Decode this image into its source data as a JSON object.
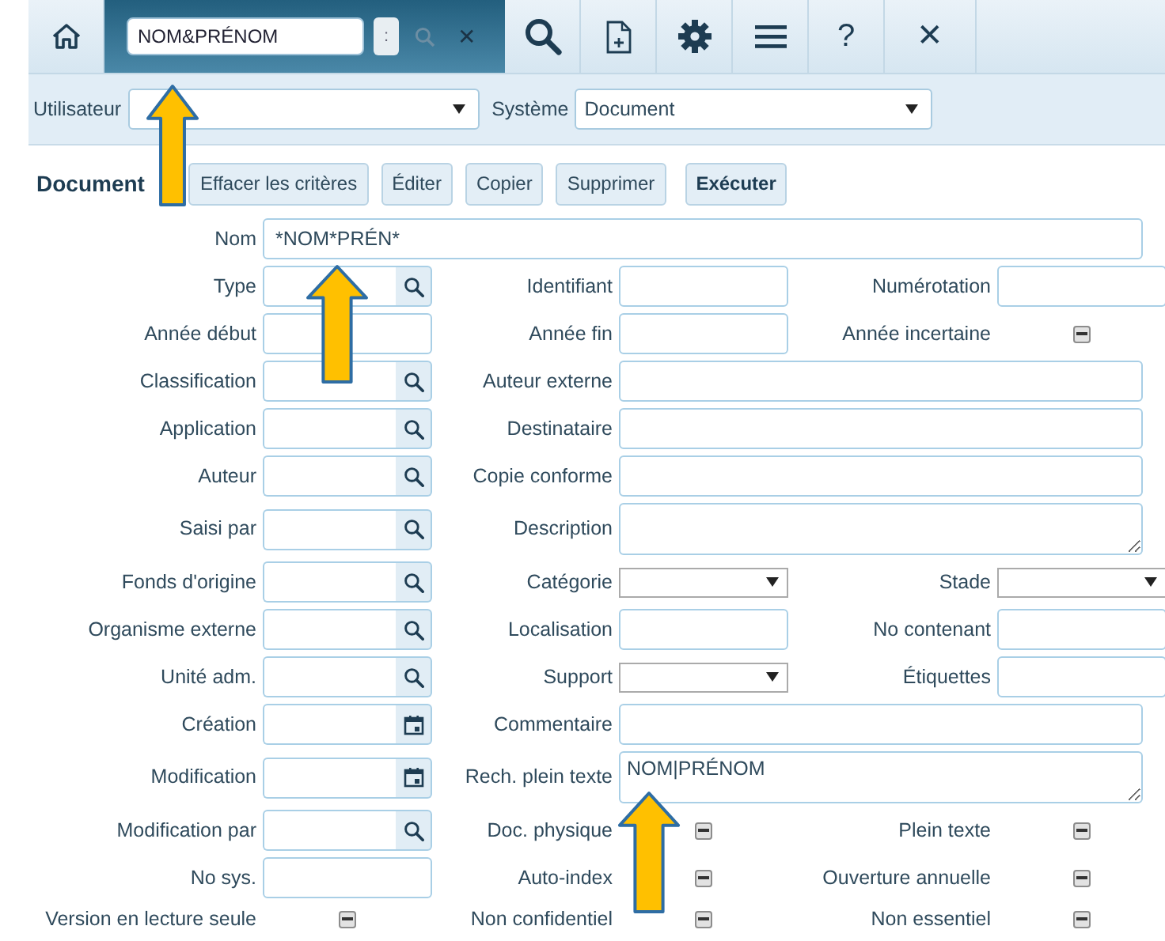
{
  "toolbar": {
    "search_panel": {
      "value": "NOM&PRÉNOM",
      "separator_button": ":",
      "close_label": "✕"
    },
    "buttons": [
      {
        "kind": "search"
      },
      {
        "kind": "new-document"
      },
      {
        "kind": "settings"
      },
      {
        "kind": "menu"
      },
      {
        "kind": "text",
        "label": "?"
      },
      {
        "kind": "text",
        "label": "✕"
      }
    ]
  },
  "filters": [
    {
      "label": "Utilisateur"
    },
    {
      "label": "Système",
      "value": "Document"
    }
  ],
  "form": {
    "title": "Document",
    "actions": [
      {
        "label": "Effacer les critères",
        "primary": false
      },
      {
        "label": "Éditer",
        "primary": false
      },
      {
        "label": "Copier",
        "primary": false
      },
      {
        "label": "Supprimer",
        "primary": false
      },
      {
        "label": "Exécuter",
        "primary": true
      }
    ],
    "rows": [
      [
        {
          "label": "Nom",
          "kind": "wide",
          "value": "*NOM*PRÉN*"
        }
      ],
      [
        {
          "label": "Type",
          "kind": "lookup"
        },
        {
          "label": "Identifiant",
          "kind": "text"
        },
        {
          "label": "Numérotation",
          "kind": "text"
        }
      ],
      [
        {
          "label": "Année début",
          "kind": "text"
        },
        {
          "label": "Année fin",
          "kind": "text"
        },
        {
          "label": "Année incertaine",
          "kind": "tristate",
          "indeterminate": true
        }
      ],
      [
        {
          "label": "Classification",
          "kind": "lookup"
        },
        {
          "label": "Auteur externe",
          "kind": "wide"
        }
      ],
      [
        {
          "label": "Application",
          "kind": "lookup"
        },
        {
          "label": "Destinataire",
          "kind": "wide"
        }
      ],
      [
        {
          "label": "Auteur",
          "kind": "lookup"
        },
        {
          "label": "Copie conforme",
          "kind": "wide"
        }
      ],
      [
        {
          "label": "Saisi par",
          "kind": "lookup"
        },
        {
          "label": "Description",
          "kind": "textarea"
        }
      ],
      [
        {
          "label": "Fonds d'origine",
          "kind": "lookup"
        },
        {
          "label": "Catégorie",
          "kind": "select"
        },
        {
          "label": "Stade",
          "kind": "select"
        }
      ],
      [
        {
          "label": "Organisme externe",
          "kind": "lookup"
        },
        {
          "label": "Localisation",
          "kind": "text"
        },
        {
          "label": "No contenant",
          "kind": "text"
        }
      ],
      [
        {
          "label": "Unité adm.",
          "kind": "lookup"
        },
        {
          "label": "Support",
          "kind": "select"
        },
        {
          "label": "Étiquettes",
          "kind": "text"
        }
      ],
      [
        {
          "label": "Création",
          "kind": "date"
        },
        {
          "label": "Commentaire",
          "kind": "wide"
        }
      ],
      [
        {
          "label": "Modification",
          "kind": "date"
        },
        {
          "label": "Rech. plein texte",
          "kind": "textarea",
          "value": "NOM|PRÉNOM"
        }
      ],
      [
        {
          "label": "Modification par",
          "kind": "lookup"
        },
        {
          "label": "Doc. physique",
          "kind": "tristate",
          "indeterminate": true
        },
        {
          "label": "Plein texte",
          "kind": "tristate",
          "indeterminate": true
        }
      ],
      [
        {
          "label": "No sys.",
          "kind": "text"
        },
        {
          "label": "Auto-index",
          "kind": "tristate",
          "indeterminate": true
        },
        {
          "label": "Ouverture annuelle",
          "kind": "tristate",
          "indeterminate": true
        }
      ],
      [
        {
          "label": "Version en lecture seule",
          "kind": "tristate",
          "indeterminate": true
        },
        {
          "label": "Non confidentiel",
          "kind": "tristate",
          "indeterminate": true
        },
        {
          "label": "Non essentiel",
          "kind": "tristate",
          "indeterminate": true
        }
      ]
    ]
  }
}
